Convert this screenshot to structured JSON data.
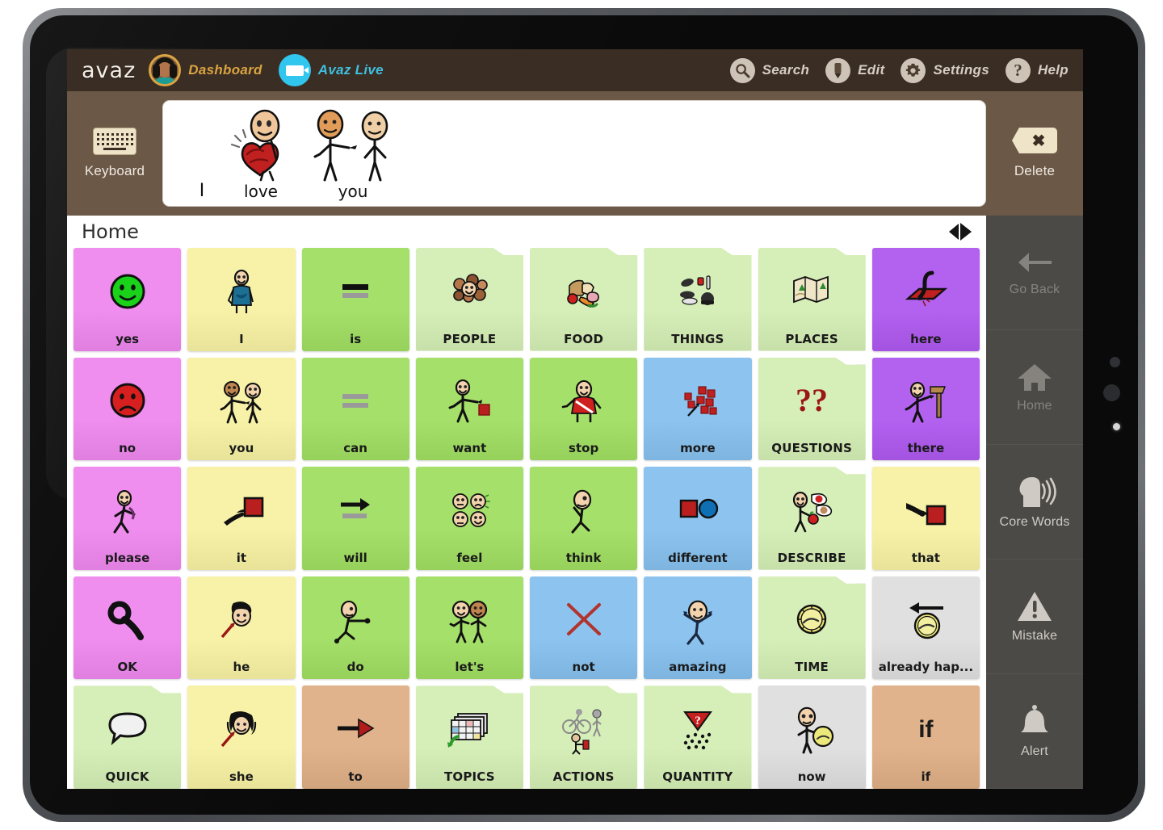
{
  "app": {
    "brand": "avaz",
    "nav": [
      {
        "name": "dashboard",
        "label": "Dashboard",
        "icon": "avatar-icon"
      },
      {
        "name": "avaz-live",
        "label": "Avaz Live",
        "icon": "video-camera-icon"
      }
    ],
    "tools": [
      {
        "name": "search",
        "label": "Search",
        "icon": "search-icon"
      },
      {
        "name": "edit",
        "label": "Edit",
        "icon": "pencil-icon"
      },
      {
        "name": "settings",
        "label": "Settings",
        "icon": "gear-icon"
      },
      {
        "name": "help",
        "label": "Help",
        "icon": "question-mark-icon"
      }
    ]
  },
  "sentence_bar": {
    "keyboard_label": "Keyboard",
    "delete_label": "Delete",
    "words": [
      {
        "text": "I",
        "pictogram": "none"
      },
      {
        "text": "love",
        "pictogram": "person-hugging-heart"
      },
      {
        "text": "you",
        "pictogram": "person-pointing-at-person"
      }
    ]
  },
  "board": {
    "breadcrumb": "Home",
    "page_prev": "◀",
    "page_next": "▶",
    "colors": {
      "pink": "#f08ef0",
      "yellow": "#f7f2a8",
      "green": "#a5e06a",
      "folder_green": "#d6eeb8",
      "blue": "#8dc4ef",
      "purple": "#b362f0",
      "gray": "#e0e0e0",
      "tan": "#e0b38c"
    },
    "cells": [
      {
        "label": "yes",
        "type": "word",
        "color": "pink",
        "art": "smiley-green-icon"
      },
      {
        "label": "I",
        "type": "word",
        "color": "yellow",
        "art": "person-self-icon"
      },
      {
        "label": "is",
        "type": "word",
        "color": "green",
        "art": "equals-bar-icon"
      },
      {
        "label": "PEOPLE",
        "type": "folder",
        "color": "folder_green",
        "art": "crowd-faces-icon"
      },
      {
        "label": "FOOD",
        "type": "folder",
        "color": "folder_green",
        "art": "food-items-icon"
      },
      {
        "label": "THINGS",
        "type": "folder",
        "color": "folder_green",
        "art": "objects-icon"
      },
      {
        "label": "PLACES",
        "type": "folder",
        "color": "folder_green",
        "art": "maps-icon"
      },
      {
        "label": "here",
        "type": "word",
        "color": "purple",
        "art": "pointing-down-mat-icon"
      },
      {
        "label": "no",
        "type": "word",
        "color": "pink",
        "art": "frowny-red-icon"
      },
      {
        "label": "you",
        "type": "word",
        "color": "yellow",
        "art": "person-pointing-icon"
      },
      {
        "label": "can",
        "type": "word",
        "color": "green",
        "art": "double-gray-bar-icon"
      },
      {
        "label": "want",
        "type": "word",
        "color": "green",
        "art": "person-reaching-box-icon"
      },
      {
        "label": "stop",
        "type": "word",
        "color": "green",
        "art": "person-stop-icon"
      },
      {
        "label": "more",
        "type": "word",
        "color": "blue",
        "art": "blocks-arrow-icon"
      },
      {
        "label": "QUESTIONS",
        "type": "folder",
        "color": "folder_green",
        "art": "double-question-icon"
      },
      {
        "label": "there",
        "type": "word",
        "color": "purple",
        "art": "person-signpost-icon"
      },
      {
        "label": "please",
        "type": "word",
        "color": "pink",
        "art": "person-begging-icon"
      },
      {
        "label": "it",
        "type": "word",
        "color": "yellow",
        "art": "hand-pointing-box-icon"
      },
      {
        "label": "will",
        "type": "word",
        "color": "green",
        "art": "arrow-right-bar-icon"
      },
      {
        "label": "feel",
        "type": "word",
        "color": "green",
        "art": "four-faces-icon"
      },
      {
        "label": "think",
        "type": "word",
        "color": "green",
        "art": "person-thinking-icon"
      },
      {
        "label": "different",
        "type": "word",
        "color": "blue",
        "art": "square-circle-icon"
      },
      {
        "label": "DESCRIBE",
        "type": "folder",
        "color": "folder_green",
        "art": "person-describing-icon"
      },
      {
        "label": "that",
        "type": "word",
        "color": "yellow",
        "art": "hand-point-far-box-icon"
      },
      {
        "label": "OK",
        "type": "word",
        "color": "pink",
        "art": "ok-hand-icon"
      },
      {
        "label": "he",
        "type": "word",
        "color": "yellow",
        "art": "boy-face-arrow-icon"
      },
      {
        "label": "do",
        "type": "word",
        "color": "green",
        "art": "person-doing-icon"
      },
      {
        "label": "let's",
        "type": "word",
        "color": "green",
        "art": "two-people-icon"
      },
      {
        "label": "not",
        "type": "word",
        "color": "blue",
        "art": "red-cross-icon"
      },
      {
        "label": "amazing",
        "type": "word",
        "color": "blue",
        "art": "person-excited-icon"
      },
      {
        "label": "TIME",
        "type": "folder",
        "color": "folder_green",
        "art": "clock-icon"
      },
      {
        "label": "already hap...",
        "type": "word",
        "color": "gray",
        "art": "clock-back-arrow-icon"
      },
      {
        "label": "QUICK",
        "type": "folder",
        "color": "folder_green",
        "art": "speech-bubble-icon"
      },
      {
        "label": "she",
        "type": "word",
        "color": "yellow",
        "art": "girl-face-arrow-icon"
      },
      {
        "label": "to",
        "type": "word",
        "color": "tan",
        "art": "arrow-right-red-icon"
      },
      {
        "label": "TOPICS",
        "type": "folder",
        "color": "folder_green",
        "art": "grid-pages-icon"
      },
      {
        "label": "ACTIONS",
        "type": "folder",
        "color": "folder_green",
        "art": "cyclist-walker-icon"
      },
      {
        "label": "QUANTITY",
        "type": "folder",
        "color": "folder_green",
        "art": "dots-question-triangle-icon"
      },
      {
        "label": "now",
        "type": "word",
        "color": "gray",
        "art": "person-clock-icon"
      },
      {
        "label": "if",
        "type": "textonly",
        "color": "tan",
        "art": "if"
      }
    ]
  },
  "toolbar": {
    "items": [
      {
        "label": "Go Back",
        "icon": "arrow-left-icon",
        "state": "dim"
      },
      {
        "label": "Home",
        "icon": "house-icon",
        "state": "dim"
      },
      {
        "label": "Core Words",
        "icon": "speaking-head-icon",
        "state": "on"
      },
      {
        "label": "Mistake",
        "icon": "warning-triangle-icon",
        "state": "on"
      },
      {
        "label": "Alert",
        "icon": "bell-icon",
        "state": "on"
      }
    ]
  }
}
